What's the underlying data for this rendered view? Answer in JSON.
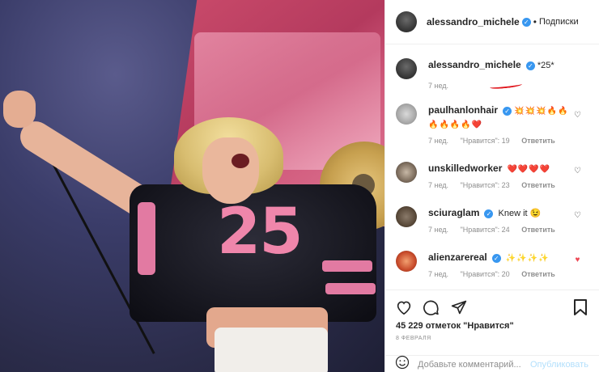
{
  "post": {
    "author": "alessandro_michele",
    "follow_label": "Подписки",
    "separator": "•",
    "caption": "*25*",
    "caption_time": "7 нед."
  },
  "comments": [
    {
      "user": "paulhanlonhair",
      "verified": true,
      "text": "💥💥💥🔥🔥🔥🔥🔥🔥❤️",
      "time": "7 нед.",
      "likes": "\"Нравится\": 19",
      "reply": "Ответить",
      "liked": false
    },
    {
      "user": "unskilledworker",
      "verified": false,
      "text": "❤️❤️❤️❤️",
      "time": "7 нед.",
      "likes": "\"Нравится\": 23",
      "reply": "Ответить",
      "liked": false
    },
    {
      "user": "sciuraglam",
      "verified": true,
      "text": "Knew it 😉",
      "time": "7 нед.",
      "likes": "\"Нравится\": 24",
      "reply": "Ответить",
      "liked": false
    },
    {
      "user": "alienzarereal",
      "verified": true,
      "text": "✨✨✨✨",
      "time": "7 нед.",
      "likes": "\"Нравится\": 20",
      "reply": "Ответить",
      "liked": true
    }
  ],
  "actions": {
    "likes_count": "45 229 отметок \"Нравится\"",
    "date": "8 ФЕВРАЛЯ",
    "comment_placeholder": "Добавьте комментарий...",
    "publish_label": "Опубликовать"
  },
  "icons": {
    "like": "heart-outline-icon",
    "comment": "speech-bubble-icon",
    "share": "paper-plane-icon",
    "save": "bookmark-icon"
  },
  "photo": {
    "jersey_number": "25"
  },
  "colors": {
    "verified": "#3897f0",
    "liked_heart": "#ed4956",
    "publish_disabled": "#b2dffc",
    "meta_gray": "#8e8e8e"
  }
}
